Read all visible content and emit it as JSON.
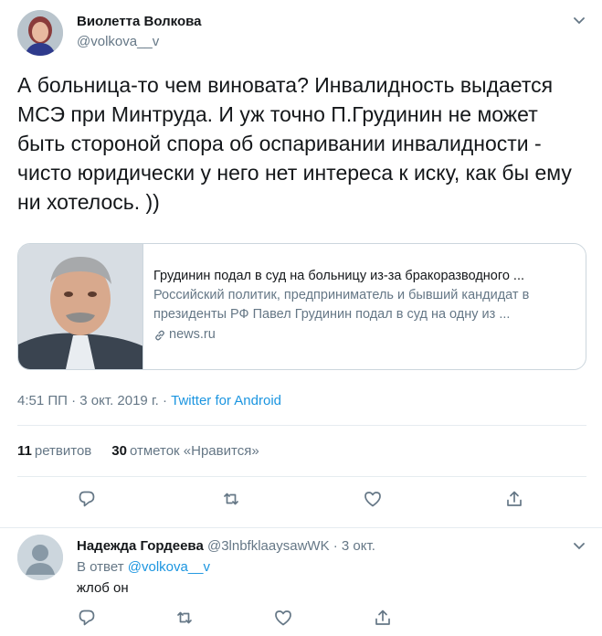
{
  "tweet": {
    "author_name": "Виолетта Волкова",
    "author_handle": "@volkova__v",
    "text": "А больница-то чем виновата? Инвалидность выдается МСЭ при Минтруда. И уж точно П.Грудинин не может быть стороной спора об оспаривании инвалидности - чисто юридически у него нет интереса к иску, как бы ему ни хотелось. ))",
    "card": {
      "title": "Грудинин подал в суд на больницу из-за бракоразводного ...",
      "description": "Российский политик, предприниматель и бывший кандидат в президенты РФ Павел Грудинин подал в суд на одну из ...",
      "domain": "news.ru"
    },
    "time": "4:51 ПП",
    "date": "3 окт. 2019 г.",
    "separator": "·",
    "source": "Twitter for Android",
    "stats": {
      "retweets_count": "11",
      "retweets_label": "ретвитов",
      "likes_count": "30",
      "likes_label": "отметок «Нравится»"
    }
  },
  "reply": {
    "author_name": "Надежда Гордеева",
    "author_handle": "@3lnbfklaaysawWK",
    "date": "3 окт.",
    "in_reply_prefix": "В ответ",
    "in_reply_mention": "@volkova__v",
    "text": "жлоб он"
  },
  "icons": [
    "reply-icon",
    "retweet-icon",
    "like-icon",
    "share-icon",
    "chevron-down-icon",
    "link-icon"
  ],
  "colors": {
    "link": "#1b95e0",
    "secondary_text": "#657786",
    "border": "#e6ecf0",
    "primary_text": "#14171a"
  }
}
